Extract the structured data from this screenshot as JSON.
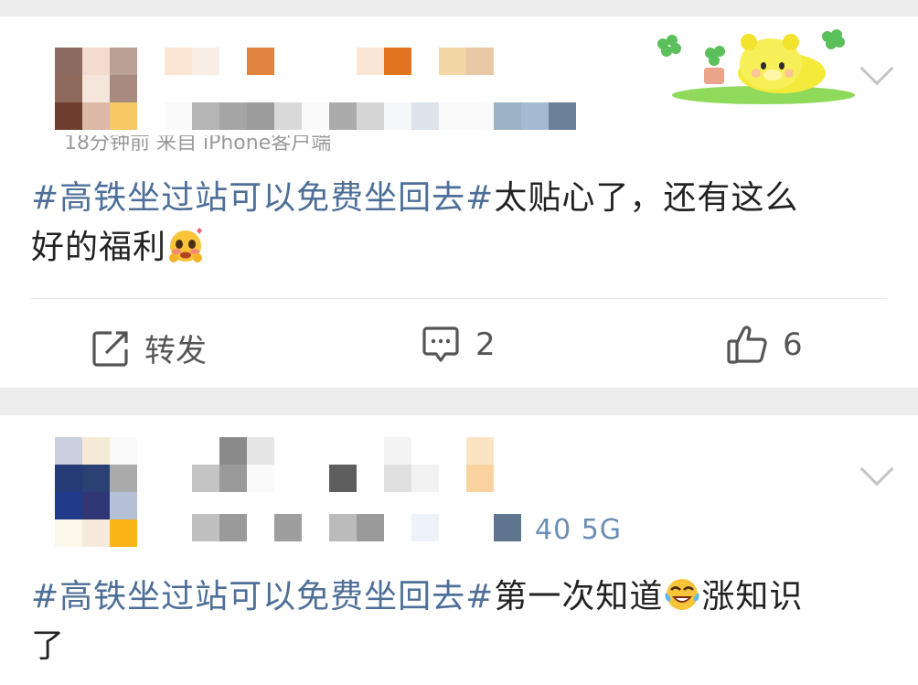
{
  "posts": [
    {
      "hashtag": "#高铁坐过站可以免费坐回去#",
      "body_after_tag": "太贴心了，还有这么",
      "body_line2": "好的福利",
      "emoji_icon": "blushing-face-emoji",
      "actions": {
        "repost_label": "转发",
        "comment_count": "2",
        "like_count": "6"
      },
      "meta_partial": "18分钟前 来自 iPhone客户端"
    },
    {
      "hashtag": "#高铁坐过站可以免费坐回去#",
      "body_after_tag": "第一次知道",
      "body_tail": "涨知识",
      "body_line2": "了",
      "emoji_icon": "laughing-tears-emoji",
      "meta_visible": "40 5G"
    }
  ],
  "colors": {
    "page_bg": "#ededed",
    "card_bg": "#ffffff",
    "hashtag": "#4e6f98",
    "meta_blue": "#6a8fb5",
    "icon_gray": "#555555"
  },
  "icons": {
    "repost": "repost-icon",
    "comment": "comment-icon",
    "like": "thumbs-up-icon",
    "more": "chevron-down-icon",
    "sticker": "yellow-bear-sticker"
  }
}
